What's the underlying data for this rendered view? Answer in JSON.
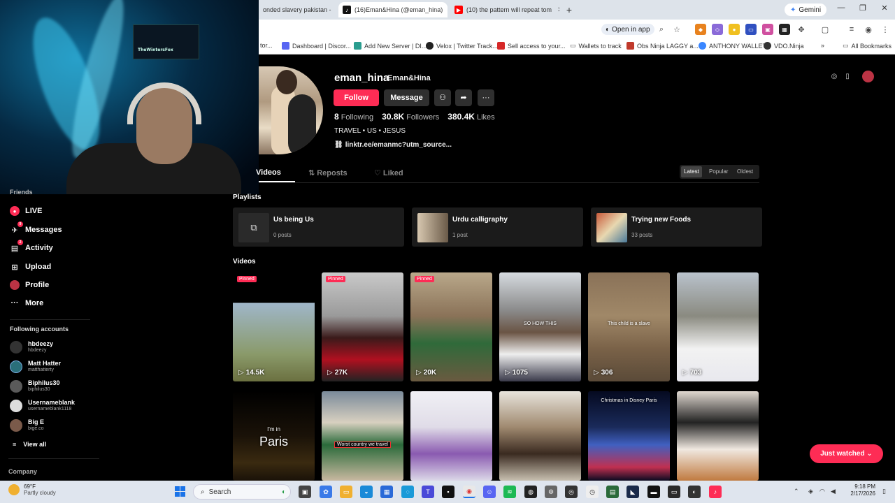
{
  "chrome": {
    "tabs": [
      {
        "title": "onded slavery pakistan -",
        "favicon_color": "#4285f4",
        "favicon": "",
        "active": false
      },
      {
        "title": "(16)Eman&Hina (@eman_hina)",
        "favicon_color": "#111111",
        "favicon": "♪",
        "active": true
      },
      {
        "title": "(10) the pattern will repeat tom",
        "favicon_color": "#ff0000",
        "favicon": "▶",
        "active": false
      }
    ],
    "new_tab": "+",
    "gemini": "Gemini",
    "open_in_app": "Open in app",
    "window_controls": [
      "—",
      "❐",
      "✕"
    ],
    "bookmarks": [
      {
        "label": "tor...",
        "color": "#888888"
      },
      {
        "label": "Dashboard | Discor...",
        "color": "#5865f2"
      },
      {
        "label": "Add New Server | DI...",
        "color": "#2a9d8f"
      },
      {
        "label": "Velox | Twitter Track...",
        "color": "#222222"
      },
      {
        "label": "Sell access to your...",
        "color": "#d62828"
      },
      {
        "label": "Wallets to track",
        "color": "#777777"
      },
      {
        "label": "Obs Ninja LAGGY a...",
        "color": "#c0392b"
      },
      {
        "label": "ANTHONY WALLET",
        "color": "#3a86ff"
      },
      {
        "label": "VDO.Ninja",
        "color": "#333333"
      },
      {
        "label": "»",
        "color": ""
      },
      {
        "label": "All Bookmarks",
        "color": "#777777"
      }
    ]
  },
  "webcam": {
    "label": "TheWintersFox"
  },
  "sidebar": {
    "partial_item": "Friends",
    "items": [
      {
        "label": "LIVE",
        "icon": "live-icon",
        "glyph": "●",
        "badge": ""
      },
      {
        "label": "Messages",
        "icon": "messages-icon",
        "glyph": "✈",
        "badge": "9"
      },
      {
        "label": "Activity",
        "icon": "activity-icon",
        "glyph": "▤",
        "badge": "2"
      },
      {
        "label": "Upload",
        "icon": "upload-icon",
        "glyph": "⊞",
        "badge": ""
      },
      {
        "label": "Profile",
        "icon": "profile-icon",
        "glyph": "◉",
        "badge": ""
      },
      {
        "label": "More",
        "icon": "more-icon",
        "glyph": "···",
        "badge": ""
      }
    ],
    "following_heading": "Following accounts",
    "accounts": [
      {
        "name": "hbdeezy",
        "handle": "hbdeezy",
        "color": "#333333"
      },
      {
        "name": "Matt Hatter",
        "handle": "matthatterty",
        "color": "#2a6f7a"
      },
      {
        "name": "Biphilus30",
        "handle": "biphilus30",
        "color": "#5a5a5a"
      },
      {
        "name": "Usernameblank",
        "handle": "usernameblank1118",
        "color": "#dddddd"
      },
      {
        "name": "Big E",
        "handle": "bige.co",
        "color": "#7a5a4a"
      }
    ],
    "view_all": "View all",
    "company": "Company"
  },
  "profile": {
    "username": "eman_hina",
    "nickname": "Eman&Hina",
    "follow_label": "Follow",
    "message_label": "Message",
    "stats": {
      "following_value": "8",
      "following_label": "Following",
      "followers_value": "30.8K",
      "followers_label": "Followers",
      "likes_value": "380.4K",
      "likes_label": "Likes"
    },
    "bio": "TRAVEL • US • JESUS",
    "link": "linktr.ee/emanmc?utm_source..."
  },
  "tabs": {
    "videos": "Videos",
    "reposts": "Reposts",
    "liked": "Liked",
    "sort": [
      "Latest",
      "Popular",
      "Oldest"
    ]
  },
  "playlists": {
    "heading": "Playlists",
    "items": [
      {
        "title": "Us being Us",
        "count": "0 posts"
      },
      {
        "title": "Urdu calligraphy",
        "count": "1 post"
      },
      {
        "title": "Trying new Foods",
        "count": "33 posts"
      }
    ]
  },
  "videos": {
    "heading": "Videos",
    "pinned_label": "Pinned",
    "row1": [
      {
        "views": "14.5K",
        "pinned": true,
        "caption": "",
        "bg": "linear-gradient(180deg,#000 0%,#000 28%,#9fb6c9 28%,#8a9a6a 75%,#6b7040 100%)"
      },
      {
        "views": "27K",
        "pinned": true,
        "caption": "",
        "bg": "linear-gradient(180deg,#c9c9c9 0%,#9a9a9a 40%,#3a1a1a 60%,#b01020 80%,#222 100%)"
      },
      {
        "views": "20K",
        "pinned": true,
        "caption": "",
        "bg": "linear-gradient(180deg,#b9a88a 0%,#8a7258 40%,#2f6a3a 65%,#6a5a40 100%)"
      },
      {
        "views": "1075",
        "pinned": false,
        "caption": "SO HOW THIS",
        "bg": "linear-gradient(180deg,#d6dbe0 0%,#8a8a8a 35%,#6a5444 55%,#eeeeee 75%,#3a3a4a 100%)"
      },
      {
        "views": "306",
        "pinned": false,
        "caption": "This child is a slave",
        "bg": "linear-gradient(180deg,#8a7258 0%,#a08868 40%,#7a6248 70%,#5a4a38 100%)"
      },
      {
        "views": "703",
        "pinned": false,
        "caption": "",
        "bg": "linear-gradient(180deg,#b9c2cc 0%,#8a8a80 40%,#f2f2f2 70%,#e8e8ee 100%)"
      }
    ],
    "row2": [
      {
        "caption": "Paris",
        "pre": "I'm in",
        "bg": "linear-gradient(180deg,#000 0%,#1a1208 50%,#3a2a10 80%,#1a1208 100%)"
      },
      {
        "caption": "Worst country we travel",
        "pre": "",
        "bg": "linear-gradient(180deg,#7a8a9a 0%,#d8d0c0 35%,#2a6a3a 60%,#c8b8a0 100%)"
      },
      {
        "caption": "",
        "pre": "",
        "bg": "linear-gradient(180deg,#f0f0f4 0%,#e0dce8 40%,#8a5ab0 70%,#dcd8e8 100%)"
      },
      {
        "caption": "",
        "pre": "",
        "bg": "linear-gradient(180deg,#e8e4dc 0%,#a08a70 40%,#3a2a20 70%,#c8c0b0 100%)"
      },
      {
        "caption": "Christmas in Disney Paris",
        "pre": "",
        "bg": "linear-gradient(180deg,#050a20 0%,#1a2a5a 40%,#4060c0 60%,#c03050 85%,#0a0a20 100%)"
      },
      {
        "caption": "",
        "pre": "",
        "bg": "linear-gradient(180deg,#e0d8d0 0%,#222 35%,#f0e8e0 65%,#c07a40 100%)"
      }
    ]
  },
  "just_watched": "Just watched",
  "taskbar": {
    "weather_temp": "69°F",
    "weather_desc": "Partly cloudy",
    "search": "Search",
    "time": "9:18 PM",
    "date": "2/17/2026"
  }
}
